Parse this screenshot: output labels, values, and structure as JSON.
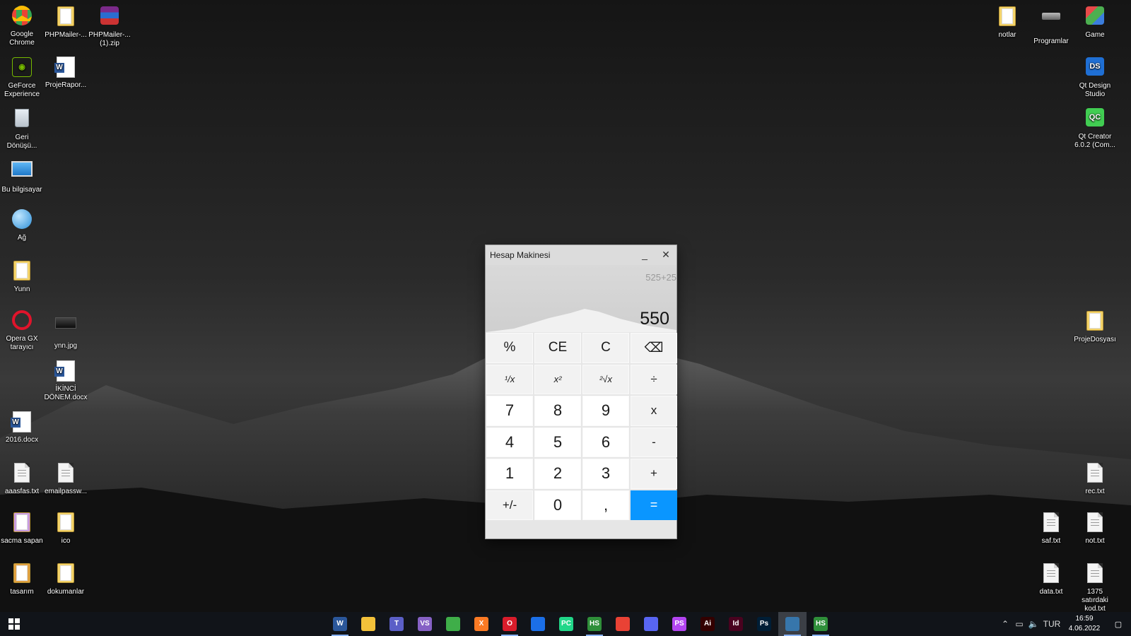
{
  "desktop": {
    "left_icons": [
      {
        "label": "Google Chrome"
      },
      {
        "label": "PHPMailer-..."
      },
      {
        "label": "PHPMailer-... (1).zip"
      },
      {
        "label": "GeForce Experience"
      },
      {
        "label": "ProjeRapor..."
      },
      {
        "label": "Geri Dönüşü..."
      },
      {
        "label": "Bu bilgisayar"
      },
      {
        "label": "Ağ"
      },
      {
        "label": "Yunn"
      },
      {
        "label": "Opera GX tarayıcı"
      },
      {
        "label": "ynn.jpg"
      },
      {
        "label": "İKİNCİ DÖNEM.docx"
      },
      {
        "label": "2016.docx"
      },
      {
        "label": "aaasfas.txt"
      },
      {
        "label": "emailpassw..."
      },
      {
        "label": "sacma sapan"
      },
      {
        "label": "ico"
      },
      {
        "label": "tasarım"
      },
      {
        "label": "dokumanlar"
      }
    ],
    "right_icons": [
      {
        "label": "notlar"
      },
      {
        "label": "Programlar"
      },
      {
        "label": "Game"
      },
      {
        "label": "Qt Design Studio"
      },
      {
        "label": "Qt Creator 6.0.2 (Com..."
      },
      {
        "label": "ProjeDosyası"
      },
      {
        "label": "rec.txt"
      },
      {
        "label": "saf.txt"
      },
      {
        "label": "not.txt"
      },
      {
        "label": "data.txt"
      },
      {
        "label": "1375 satırdaki kod.txt"
      }
    ]
  },
  "calculator": {
    "title": "Hesap Makinesi",
    "minimize": "_",
    "close": "✕",
    "expression": "525+25",
    "result": "550",
    "keys": [
      {
        "label": "%"
      },
      {
        "label": "CE"
      },
      {
        "label": "C"
      },
      {
        "label": "⌫"
      },
      {
        "label": "¹/x"
      },
      {
        "label": "x²"
      },
      {
        "label": "²√x"
      },
      {
        "label": "÷"
      },
      {
        "label": "7"
      },
      {
        "label": "8"
      },
      {
        "label": "9"
      },
      {
        "label": "x"
      },
      {
        "label": "4"
      },
      {
        "label": "5"
      },
      {
        "label": "6"
      },
      {
        "label": "-"
      },
      {
        "label": "1"
      },
      {
        "label": "2"
      },
      {
        "label": "3"
      },
      {
        "label": "+"
      },
      {
        "label": "+/-"
      },
      {
        "label": "0"
      },
      {
        "label": ","
      },
      {
        "label": "="
      }
    ]
  },
  "taskbar": {
    "apps": [
      {
        "name": "word-icon",
        "glyph": "W",
        "color": "#2b579a"
      },
      {
        "name": "file-explorer-icon",
        "glyph": "",
        "color": "#f3c13a"
      },
      {
        "name": "teams-icon",
        "glyph": "T",
        "color": "#5b5fc7"
      },
      {
        "name": "visual-studio-icon",
        "glyph": "VS",
        "color": "#8661c5"
      },
      {
        "name": "chat-app-icon",
        "glyph": "",
        "color": "#3fae49"
      },
      {
        "name": "xampp-icon",
        "glyph": "X",
        "color": "#fb7a24"
      },
      {
        "name": "opera-gx-icon",
        "glyph": "O",
        "color": "#d91c2b"
      },
      {
        "name": "app-blue-icon",
        "glyph": "",
        "color": "#1b6fe8"
      },
      {
        "name": "pycharm-icon",
        "glyph": "PC",
        "color": "#21d789"
      },
      {
        "name": "hs-app-icon",
        "glyph": "HS",
        "color": "#2f8f3a"
      },
      {
        "name": "chrome-icon",
        "glyph": "",
        "color": "#e94235"
      },
      {
        "name": "discord-icon",
        "glyph": "",
        "color": "#5865f2"
      },
      {
        "name": "phpstorm-icon",
        "glyph": "PS",
        "color": "#b345f1"
      },
      {
        "name": "illustrator-icon",
        "glyph": "Ai",
        "color": "#330000"
      },
      {
        "name": "indesign-icon",
        "glyph": "Id",
        "color": "#49021f"
      },
      {
        "name": "photoshop-icon",
        "glyph": "Ps",
        "color": "#001e36"
      },
      {
        "name": "python-icon",
        "glyph": "",
        "color": "#3776ab"
      },
      {
        "name": "hs-app-2-icon",
        "glyph": "HS",
        "color": "#2f8f3a"
      }
    ],
    "language": "TUR",
    "time": "16:59",
    "date": "4.06.2022"
  }
}
